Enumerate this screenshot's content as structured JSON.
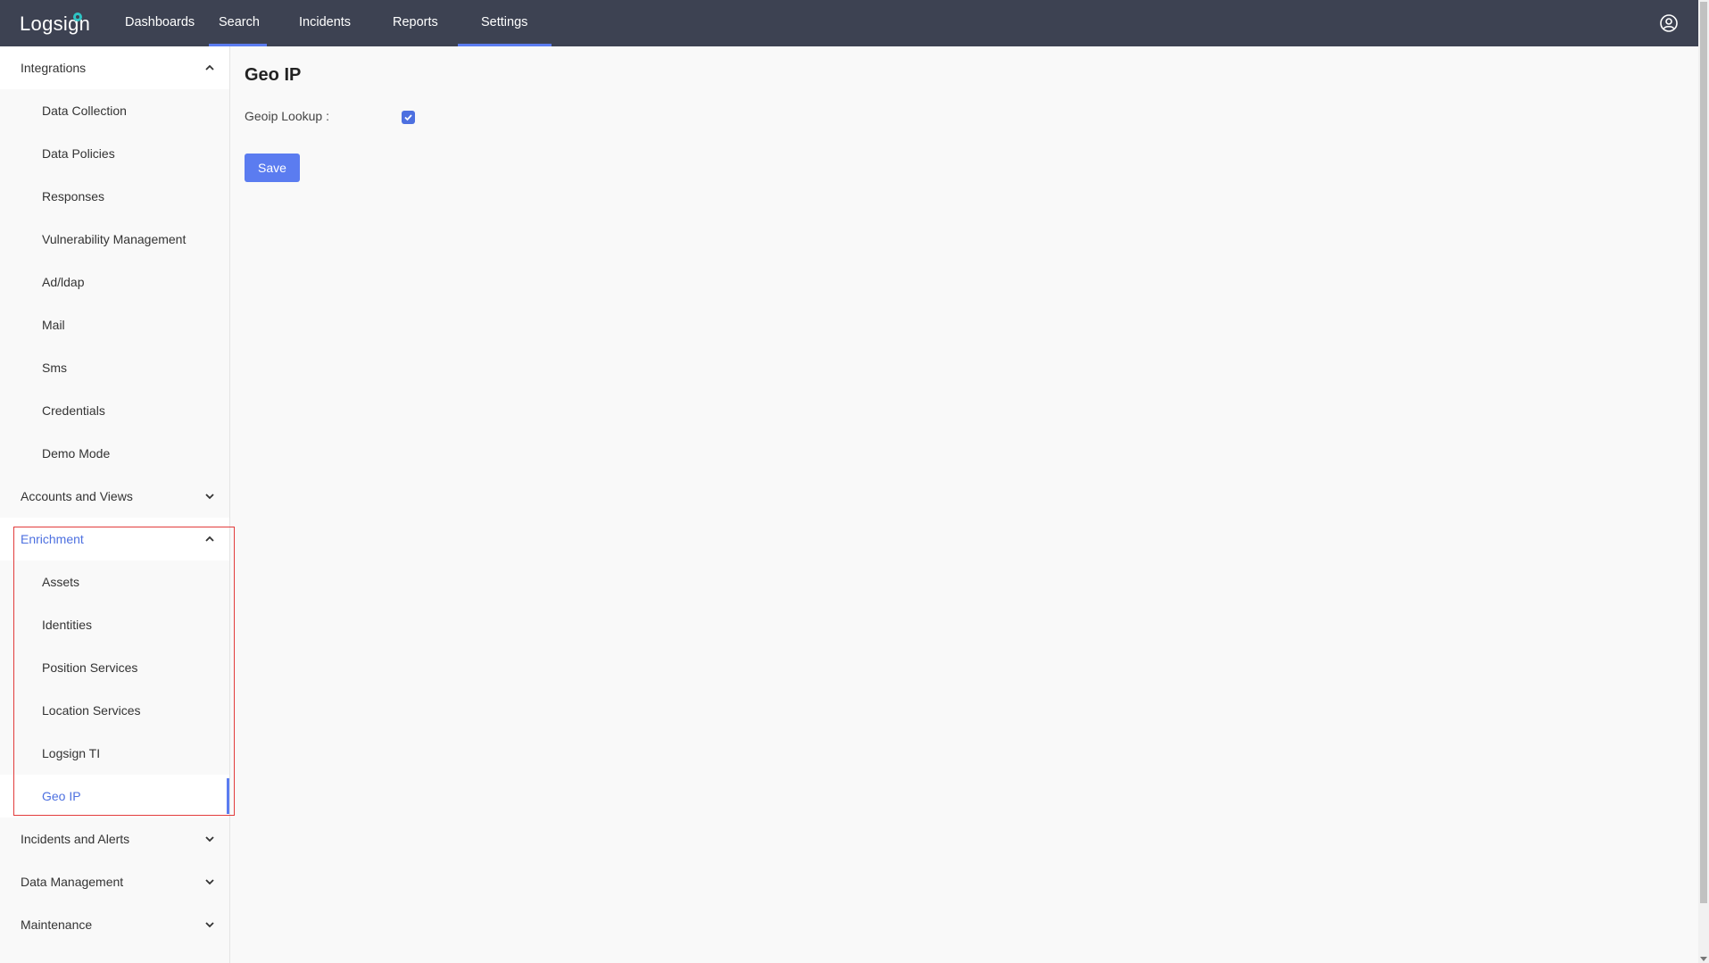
{
  "app": {
    "logo_text": "Logsign"
  },
  "nav": {
    "items": [
      {
        "label": "Dashboards"
      },
      {
        "label": "Search"
      },
      {
        "label": "Incidents"
      },
      {
        "label": "Reports"
      },
      {
        "label": "Settings"
      }
    ],
    "active": "Settings",
    "accent_color": "#5b7cf0"
  },
  "sidebar": {
    "sections": [
      {
        "label": "Integrations",
        "expanded": true,
        "items": [
          "Data Collection",
          "Data Policies",
          "Responses",
          "Vulnerability Management",
          "Ad/ldap",
          "Mail",
          "Sms",
          "Credentials",
          "Demo Mode"
        ]
      },
      {
        "label": "Accounts and Views",
        "expanded": false
      },
      {
        "label": "Enrichment",
        "expanded": true,
        "active": true,
        "items": [
          "Assets",
          "Identities",
          "Position Services",
          "Location Services",
          "Logsign TI",
          "Geo IP"
        ],
        "selected_item": "Geo IP"
      },
      {
        "label": "Incidents and Alerts",
        "expanded": false
      },
      {
        "label": "Data Management",
        "expanded": false
      },
      {
        "label": "Maintenance",
        "expanded": false
      }
    ],
    "highlight_color": "#e23c3c"
  },
  "main": {
    "title": "Geo IP",
    "fields": [
      {
        "label": "Geoip Lookup :",
        "type": "checkbox",
        "checked": true
      }
    ],
    "save_label": "Save"
  },
  "icons": {
    "user": "user-circle-icon",
    "chevron_up": "chevron-up-icon",
    "chevron_down": "chevron-down-icon",
    "check": "check-icon"
  }
}
